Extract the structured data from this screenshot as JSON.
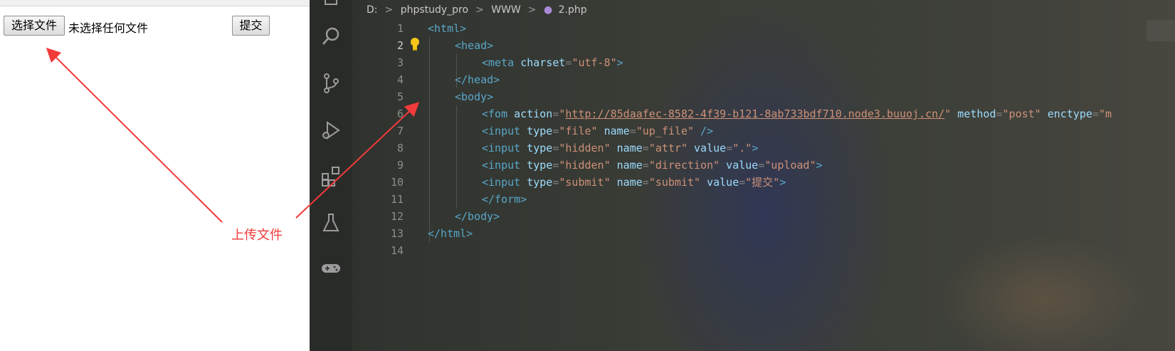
{
  "browser": {
    "choose_file_label": "选择文件",
    "file_status": "未选择任何文件",
    "submit_label": "提交"
  },
  "annotation": {
    "label": "上传文件",
    "color": "#f23a3a"
  },
  "editor": {
    "breadcrumb": [
      "D:",
      "phpstudy_pro",
      "WWW",
      "2.php"
    ],
    "lightbulb_icon": "lightbulb-icon",
    "activity_icons": [
      "files-icon",
      "search-icon",
      "source-control-icon",
      "run-debug-icon",
      "extensions-icon",
      "testing-flask-icon",
      "gamepad-icon"
    ],
    "lines": [
      {
        "num": "1",
        "tokens": [
          [
            "tag",
            "<html>"
          ]
        ]
      },
      {
        "num": "2",
        "tokens": [
          [
            "tag",
            "<head>"
          ]
        ]
      },
      {
        "num": "3",
        "tokens": [
          [
            "tag",
            "<meta "
          ],
          [
            "attr",
            "charset"
          ],
          [
            "punct",
            "="
          ],
          [
            "val",
            "\"utf-8\""
          ],
          [
            "tag",
            ">"
          ]
        ]
      },
      {
        "num": "4",
        "tokens": [
          [
            "tag",
            "</head>"
          ]
        ]
      },
      {
        "num": "5",
        "tokens": [
          [
            "tag",
            "<body>"
          ]
        ]
      },
      {
        "num": "6",
        "tokens": [
          [
            "tag",
            "<fom "
          ],
          [
            "attr",
            "action"
          ],
          [
            "punct",
            "="
          ],
          [
            "val",
            "\""
          ],
          [
            "link",
            "http://85daafec-8582-4f39-b121-8ab733bdf710.node3.buuoj.cn/"
          ],
          [
            "val",
            "\""
          ],
          [
            "attr",
            " method"
          ],
          [
            "punct",
            "="
          ],
          [
            "val",
            "\"post\""
          ],
          [
            "attr",
            " enctype"
          ],
          [
            "punct",
            "="
          ],
          [
            "val",
            "\"m"
          ]
        ]
      },
      {
        "num": "7",
        "tokens": [
          [
            "tag",
            "<input "
          ],
          [
            "attr",
            "type"
          ],
          [
            "punct",
            "="
          ],
          [
            "val",
            "\"file\""
          ],
          [
            "attr",
            " name"
          ],
          [
            "punct",
            "="
          ],
          [
            "val",
            "\"up_file\""
          ],
          [
            "tag",
            " />"
          ]
        ]
      },
      {
        "num": "8",
        "tokens": [
          [
            "tag",
            "<input "
          ],
          [
            "attr",
            "type"
          ],
          [
            "punct",
            "="
          ],
          [
            "val",
            "\"hidden\""
          ],
          [
            "attr",
            " name"
          ],
          [
            "punct",
            "="
          ],
          [
            "val",
            "\"attr\""
          ],
          [
            "attr",
            " value"
          ],
          [
            "punct",
            "="
          ],
          [
            "val",
            "\".\""
          ],
          [
            "tag",
            ">"
          ]
        ]
      },
      {
        "num": "9",
        "tokens": [
          [
            "tag",
            "<input "
          ],
          [
            "attr",
            "type"
          ],
          [
            "punct",
            "="
          ],
          [
            "val",
            "\"hidden\""
          ],
          [
            "attr",
            " name"
          ],
          [
            "punct",
            "="
          ],
          [
            "val",
            "\"direction\""
          ],
          [
            "attr",
            " value"
          ],
          [
            "punct",
            "="
          ],
          [
            "val",
            "\"upload\""
          ],
          [
            "tag",
            ">"
          ]
        ]
      },
      {
        "num": "10",
        "tokens": [
          [
            "tag",
            "<input "
          ],
          [
            "attr",
            "type"
          ],
          [
            "punct",
            "="
          ],
          [
            "val",
            "\"submit\""
          ],
          [
            "attr",
            " name"
          ],
          [
            "punct",
            "="
          ],
          [
            "val",
            "\"submit\""
          ],
          [
            "attr",
            " value"
          ],
          [
            "punct",
            "="
          ],
          [
            "val",
            "\"提交\""
          ],
          [
            "tag",
            ">"
          ]
        ]
      },
      {
        "num": "11",
        "tokens": [
          [
            "tag",
            "</form>"
          ]
        ]
      },
      {
        "num": "12",
        "tokens": [
          [
            "tag",
            "</body>"
          ]
        ]
      },
      {
        "num": "13",
        "tokens": [
          [
            "tag",
            "</html>"
          ]
        ]
      },
      {
        "num": "14",
        "tokens": []
      }
    ],
    "indent_levels": [
      0,
      1,
      2,
      1,
      1,
      2,
      2,
      2,
      2,
      2,
      2,
      1,
      0,
      0
    ]
  }
}
